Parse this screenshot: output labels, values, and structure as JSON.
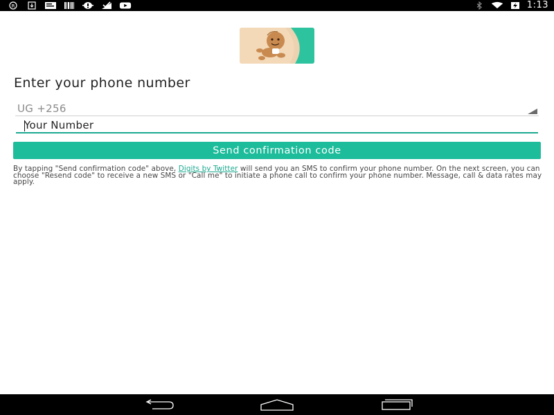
{
  "status_bar": {
    "time": "1:13",
    "left_icons": [
      "registered-icon",
      "download-icon",
      "message-icon",
      "barcode-icon",
      "android-debug-icon",
      "signal-check-icon",
      "youtube-icon"
    ],
    "right_icons": [
      "bluetooth-icon",
      "wifi-icon",
      "battery-charging-icon"
    ]
  },
  "logo": {
    "icon": "baby-logo-icon",
    "accent": "#2ec39f"
  },
  "heading": "Enter your phone number",
  "country": {
    "value": "UG +256"
  },
  "phone_input": {
    "placeholder": "Your Number",
    "value": ""
  },
  "send_button": {
    "label": "Send confirmation code",
    "color": "#1dbc9b"
  },
  "disclaimer": {
    "before_link": "By tapping \"Send confirmation code\" above, ",
    "link": "Digits by Twitter",
    "after_link": " will send you an SMS to confirm your phone number. On the next screen, you can choose \"Resend code\" to receive a new SMS or \"Call me\" to initiate a phone call to confirm your phone number. Message, call & data rates may apply."
  },
  "nav_bar": {
    "buttons": [
      "back-icon",
      "home-icon",
      "recents-icon"
    ]
  }
}
